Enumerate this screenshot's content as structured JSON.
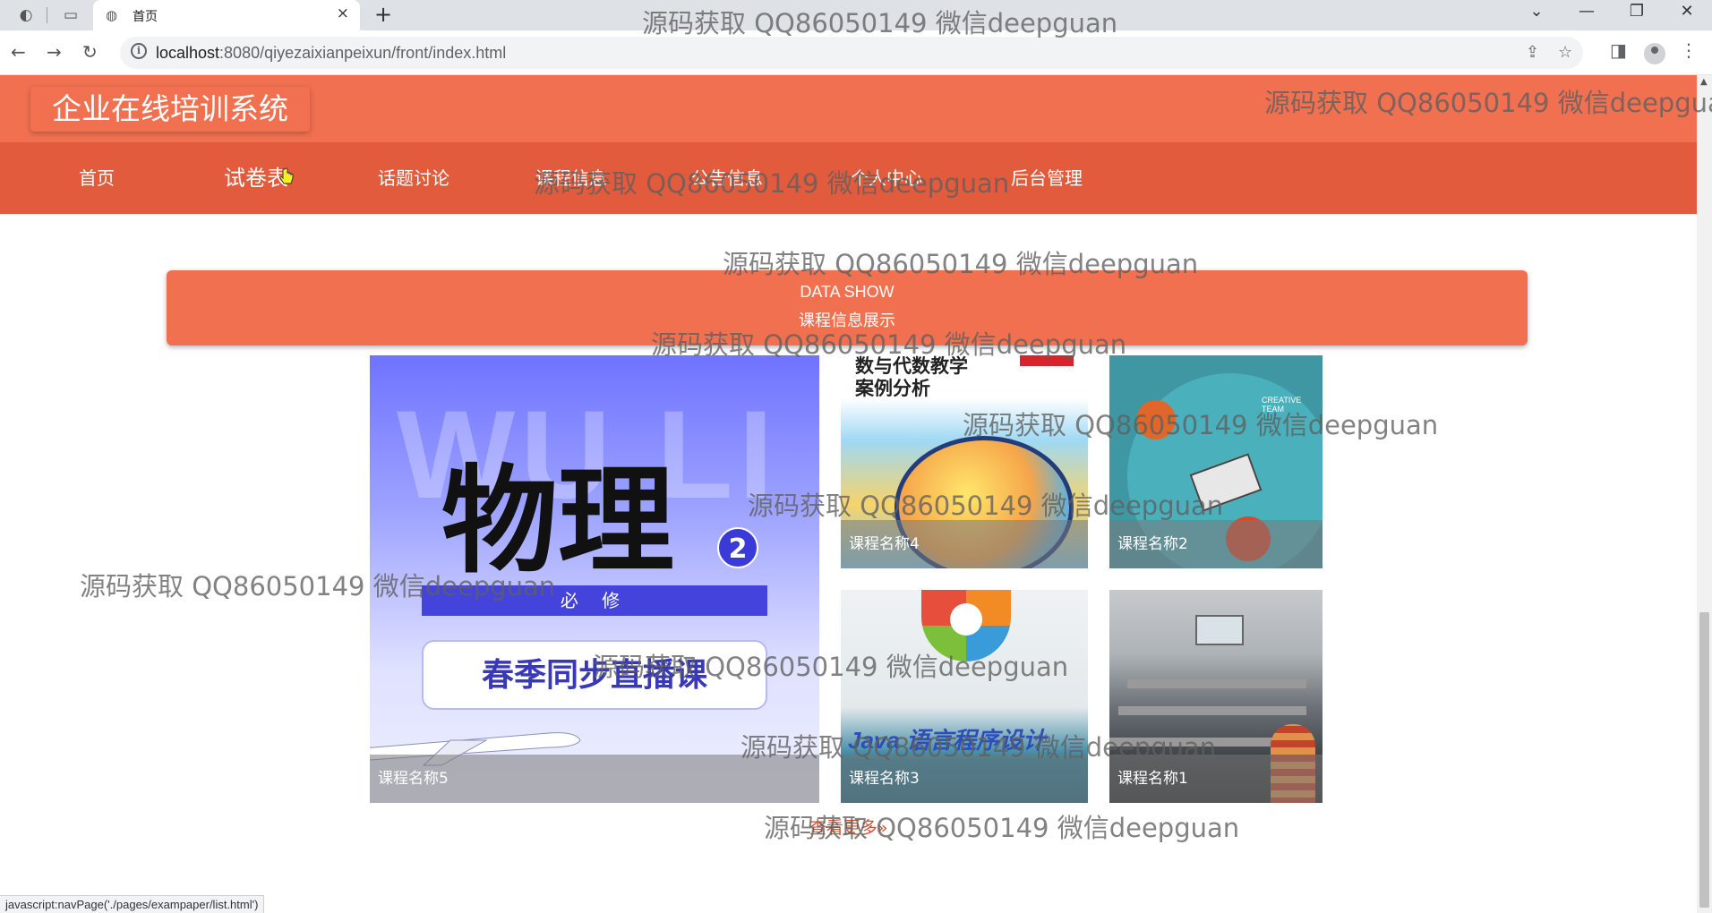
{
  "browser": {
    "tab_title": "首页",
    "url_host": "localhost",
    "url_rest": ":8080/qiyezaixianpeixun/front/index.html",
    "new_tab_symbol": "+",
    "close_symbol": "×",
    "status_url": "javascript:navPage('./pages/exampaper/list.html')"
  },
  "site": {
    "logo_text": "企业在线培训系统"
  },
  "nav": {
    "items": [
      "首页",
      "试卷表",
      "话题讨论",
      "课程信息",
      "公告信息",
      "个人中心",
      "后台管理"
    ],
    "active_index": 1
  },
  "section": {
    "title_en": "DATA SHOW",
    "title_zh": "课程信息展示"
  },
  "courses": [
    {
      "name": "课程名称5",
      "cover_text": "物理",
      "cover_bg_text": "WU LI",
      "badge": "2",
      "banner": "必 修",
      "subtitle": "春季同步直播课"
    },
    {
      "name": "课程名称4",
      "cover_text": "数与代数教学\n案例分析"
    },
    {
      "name": "课程名称2",
      "cover_text": "CREATIVE\nTEAM"
    },
    {
      "name": "课程名称3",
      "cover_text": "Java 语言程序设计"
    },
    {
      "name": "课程名称1"
    }
  ],
  "more_link": "查看更多»",
  "watermark": "源码获取 QQ86050149 微信deepguan",
  "colors": {
    "header": "#f07050",
    "nav": "#e25b3c",
    "link": "#d0502f"
  }
}
